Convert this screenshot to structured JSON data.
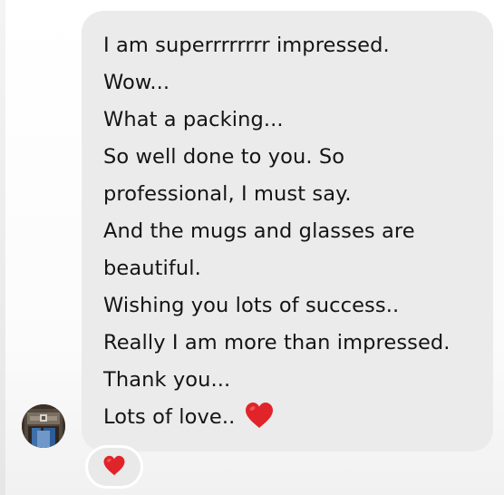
{
  "message": {
    "lines": [
      "I am superrrrrrrr impressed.",
      "Wow...",
      "What a packing...",
      "So well done to you. So",
      "professional, I must say.",
      "And the mugs and glasses are",
      "beautiful.",
      "Wishing you lots of success..",
      "Really I am more than impressed.",
      "Thank you...",
      "Lots of love.."
    ],
    "trailing_emoji": "heart-icon"
  },
  "sender": {
    "avatar_icon": "avatar-photo"
  },
  "reaction": {
    "emoji": "heart-icon",
    "count": 1
  },
  "colors": {
    "bubble": "#ebebeb",
    "text": "#141414",
    "heart": "#e0242a"
  }
}
